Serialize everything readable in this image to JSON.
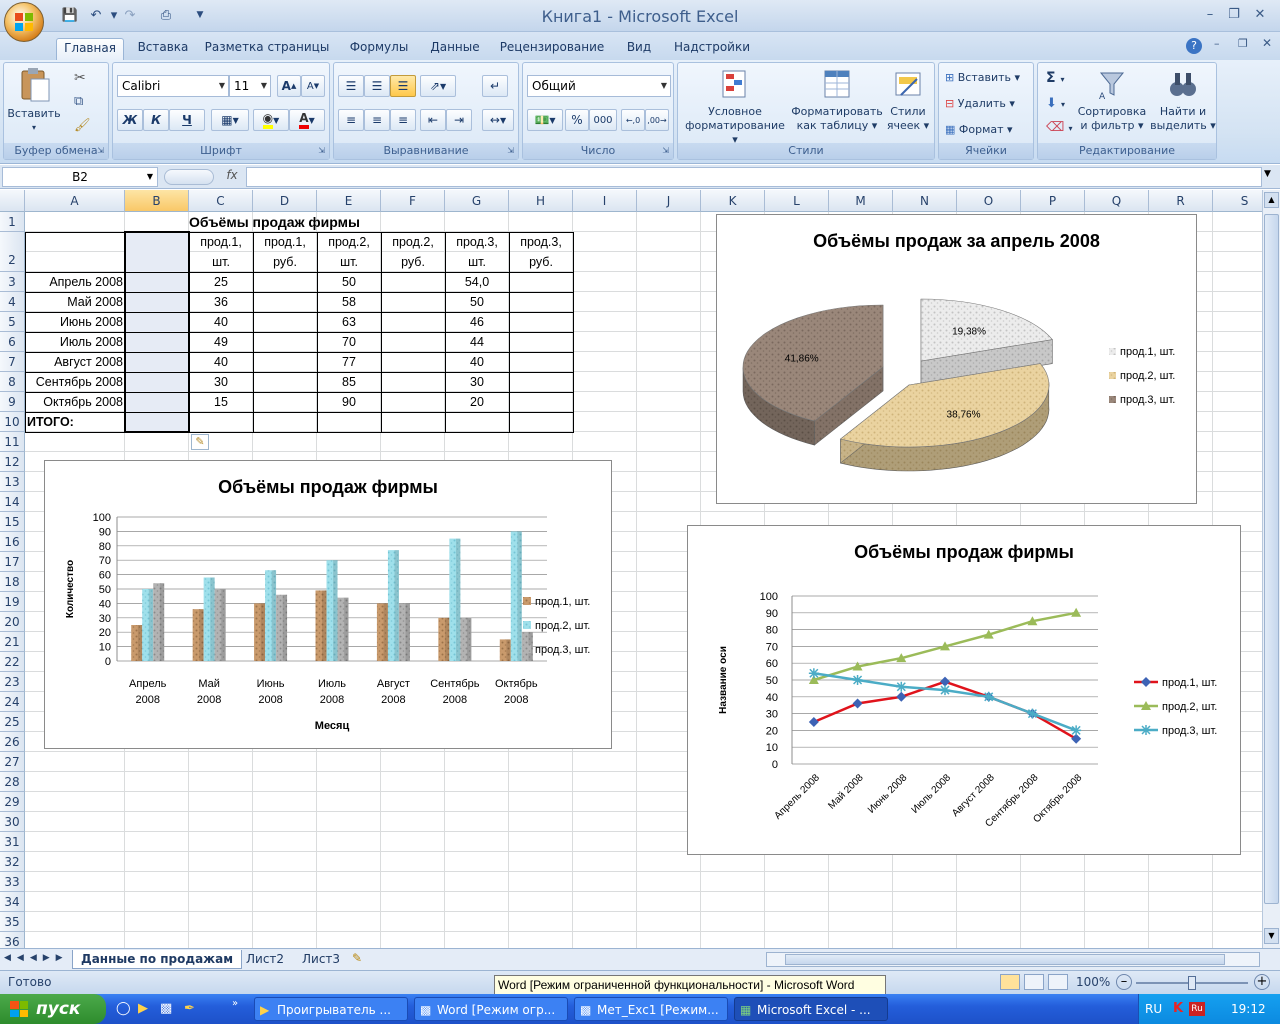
{
  "window": {
    "title": "Книга1 - Microsoft Excel"
  },
  "ribbon_tabs": [
    "Главная",
    "Вставка",
    "Разметка страницы",
    "Формулы",
    "Данные",
    "Рецензирование",
    "Вид",
    "Надстройки"
  ],
  "ribbon": {
    "clipboard": {
      "label": "Буфер обмена",
      "paste": "Вставить"
    },
    "font": {
      "label": "Шрифт",
      "name": "Calibri",
      "size": "11",
      "bold": "Ж",
      "italic": "К",
      "underline": "Ч"
    },
    "alignment": {
      "label": "Выравнивание"
    },
    "number": {
      "label": "Число",
      "format": "Общий",
      "percent": "%",
      "thousands": "000"
    },
    "styles": {
      "label": "Стили",
      "conditional": "Условное",
      "conditional2": "форматирование",
      "format_table": "Форматировать",
      "format_table2": "как таблицу",
      "cell_styles": "Стили",
      "cell_styles2": "ячеек"
    },
    "cells": {
      "label": "Ячейки",
      "insert": "Вставить",
      "delete": "Удалить",
      "format": "Формат"
    },
    "editing": {
      "label": "Редактирование",
      "sort": "Сортировка",
      "sort2": "и фильтр",
      "find": "Найти и",
      "find2": "выделить"
    }
  },
  "formula_bar": {
    "name_box": "B2",
    "fx": "fx",
    "value": ""
  },
  "columns": [
    "A",
    "B",
    "C",
    "D",
    "E",
    "F",
    "G",
    "H",
    "I",
    "J",
    "K",
    "L",
    "M",
    "N",
    "O",
    "P",
    "Q",
    "R",
    "S"
  ],
  "rows": [
    "1",
    "2",
    "3",
    "4",
    "5",
    "6",
    "7",
    "8",
    "9",
    "10",
    "11",
    "12",
    "13",
    "14",
    "15",
    "16",
    "17",
    "18",
    "19",
    "20",
    "21",
    "22",
    "23",
    "24",
    "25",
    "26",
    "27",
    "28",
    "29",
    "30",
    "31",
    "32",
    "33",
    "34",
    "35",
    "36"
  ],
  "table": {
    "title": "Объёмы продаж фирмы",
    "headers": [
      [
        "прод.1,",
        "шт."
      ],
      [
        "прод.1,",
        "руб."
      ],
      [
        "прод.2,",
        "шт."
      ],
      [
        "прод.2,",
        "руб."
      ],
      [
        "прод.3,",
        "шт."
      ],
      [
        "прод.3,",
        "руб."
      ]
    ],
    "months": [
      "Апрель 2008",
      "Май 2008",
      "Июнь 2008",
      "Июль 2008",
      "Август 2008",
      "Сентябрь 2008",
      "Октябрь 2008"
    ],
    "p1": [
      "25",
      "36",
      "40",
      "49",
      "40",
      "30",
      "15"
    ],
    "p2": [
      "50",
      "58",
      "63",
      "70",
      "77",
      "85",
      "90"
    ],
    "p3": [
      "54,0",
      "50",
      "46",
      "44",
      "40",
      "30",
      "20"
    ],
    "total": "ИТОГО:"
  },
  "chart_data": [
    {
      "type": "pie",
      "title": "Объёмы продаж за апрель 2008",
      "categories": [
        "прод.1, шт.",
        "прод.2, шт.",
        "прод.3, шт."
      ],
      "values": [
        25,
        50,
        54
      ],
      "labels": [
        "19,38%",
        "38,76%",
        "41,86%"
      ],
      "colors": [
        "#e8e8e8",
        "#e6cf98",
        "#8f7d70"
      ],
      "legend": "right"
    },
    {
      "type": "bar",
      "title": "Объёмы продаж фирмы",
      "categories": [
        [
          "Апрель",
          "2008"
        ],
        [
          "Май",
          "2008"
        ],
        [
          "Июнь",
          "2008"
        ],
        [
          "Июль",
          "2008"
        ],
        [
          "Август",
          "2008"
        ],
        [
          "Сентябрь",
          "2008"
        ],
        [
          "Октябрь",
          "2008"
        ]
      ],
      "series": [
        {
          "name": "прод.1, шт.",
          "values": [
            25,
            36,
            40,
            49,
            40,
            30,
            15
          ],
          "color": "#b9875e"
        },
        {
          "name": "прод.2, шт.",
          "values": [
            50,
            58,
            63,
            70,
            77,
            85,
            90
          ],
          "color": "#8fd8e4"
        },
        {
          "name": "прод.3, шт.",
          "values": [
            54,
            50,
            46,
            44,
            40,
            30,
            20
          ],
          "color": "#a5a5a5"
        }
      ],
      "xlabel": "Месяц",
      "ylabel": "Количество",
      "ylim": [
        0,
        100
      ],
      "yticks": [
        "0",
        "10",
        "20",
        "30",
        "40",
        "50",
        "60",
        "70",
        "80",
        "90",
        "100"
      ],
      "grid": true,
      "legend": "right"
    },
    {
      "type": "line",
      "title": "Объёмы продаж фирмы",
      "categories": [
        "Апрель 2008",
        "Май 2008",
        "Июнь 2008",
        "Июль 2008",
        "Август 2008",
        "Сентябрь 2008",
        "Октябрь 2008"
      ],
      "series": [
        {
          "name": "прод.1, шт.",
          "values": [
            25,
            36,
            40,
            49,
            40,
            30,
            15
          ],
          "color": "#e0131b",
          "marker": "diamond",
          "marker_color": "#3d63b5"
        },
        {
          "name": "прод.2, шт.",
          "values": [
            50,
            58,
            63,
            70,
            77,
            85,
            90
          ],
          "color": "#9bbb59",
          "marker": "triangle",
          "marker_color": "#9bbb59"
        },
        {
          "name": "прод.3, шт.",
          "values": [
            54,
            50,
            46,
            44,
            40,
            30,
            20
          ],
          "color": "#4bacc6",
          "marker": "star",
          "marker_color": "#4bacc6"
        }
      ],
      "ylabel": "Название оси",
      "ylim": [
        0,
        100
      ],
      "yticks": [
        "0",
        "10",
        "20",
        "30",
        "40",
        "50",
        "60",
        "70",
        "80",
        "90",
        "100"
      ],
      "grid": true,
      "legend": "right"
    }
  ],
  "sheet_tabs": [
    "Данные по продажам",
    "Лист2",
    "Лист3"
  ],
  "status": {
    "ready": "Готово",
    "zoom": "100%",
    "tooltip": "Word [Режим ограниченной функциональности] - Microsoft Word"
  },
  "taskbar": {
    "start": "пуск",
    "tasks": [
      "Проигрыватель ...",
      "Word [Режим огр...",
      "Мет_Exc1 [Режим...",
      "Microsoft Excel - ..."
    ],
    "lang": "RU",
    "time": "19:12"
  }
}
